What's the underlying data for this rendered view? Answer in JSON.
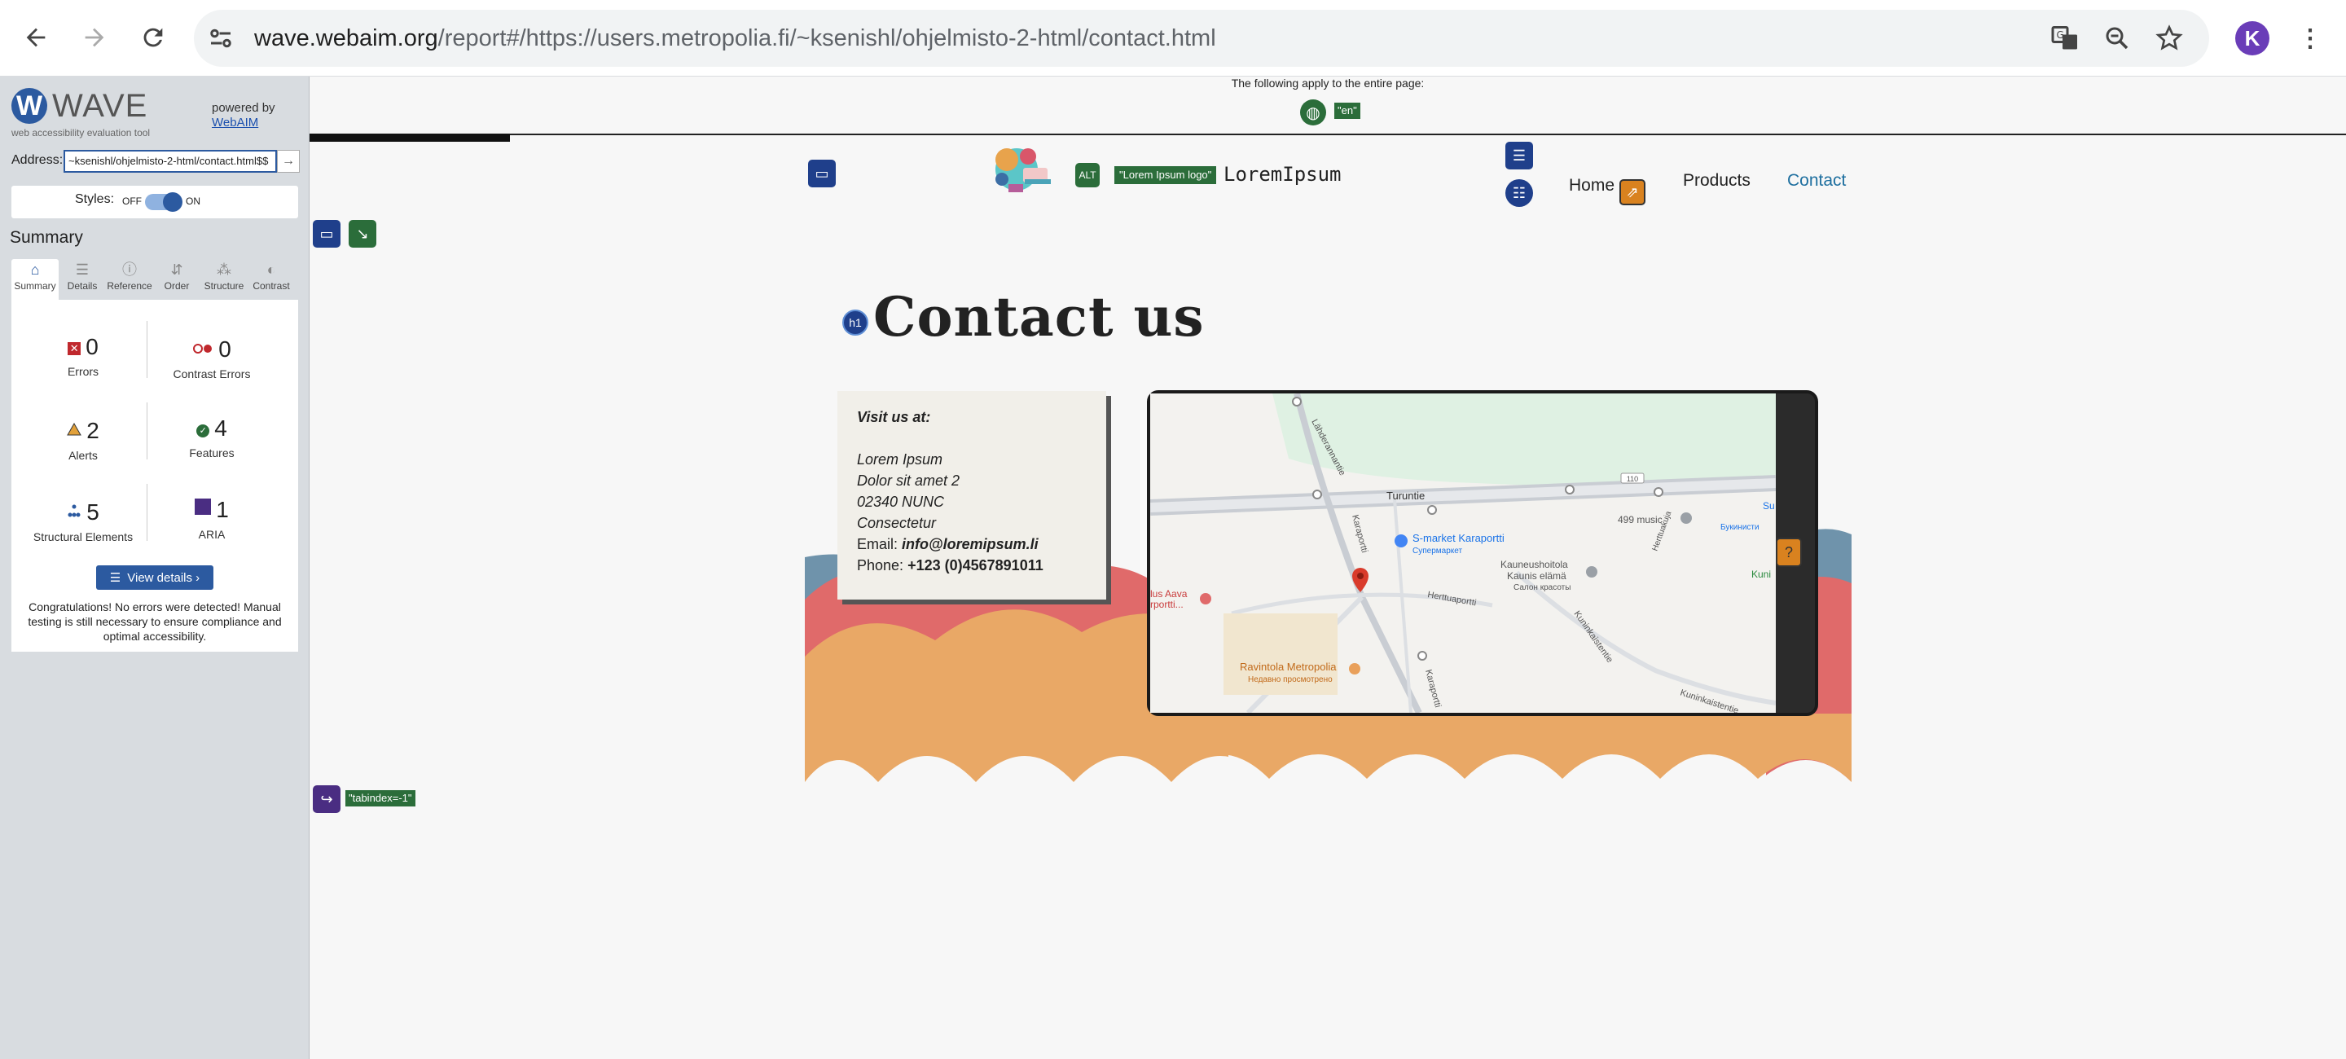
{
  "browser": {
    "url_host": "wave.webaim.org",
    "url_path": "/report#/https://users.metropolia.fi/~ksenishl/ohjelmisto-2-html/contact.html",
    "avatar_letter": "K"
  },
  "wave": {
    "logo_letter": "W",
    "title": "WAVE",
    "subtitle": "web accessibility evaluation tool",
    "powered_by": "powered by",
    "webaim": "WebAIM",
    "address_label": "Address:",
    "address_value": "~ksenishl/ohjelmisto-2-html/contact.html$$",
    "go_symbol": "→",
    "styles_label": "Styles:",
    "styles_off": "OFF",
    "styles_on": "ON",
    "summary_heading": "Summary",
    "tabs": [
      {
        "label": "Summary",
        "icon": "⌂"
      },
      {
        "label": "Details",
        "icon": "☰"
      },
      {
        "label": "Reference",
        "icon": "ⓘ"
      },
      {
        "label": "Order",
        "icon": "⇵"
      },
      {
        "label": "Structure",
        "icon": "⁂"
      },
      {
        "label": "Contrast",
        "icon": "◐"
      }
    ],
    "stats": {
      "errors": {
        "value": "0",
        "label": "Errors"
      },
      "contrast_errors": {
        "value": "0",
        "label": "Contrast Errors"
      },
      "alerts": {
        "value": "2",
        "label": "Alerts"
      },
      "features": {
        "value": "4",
        "label": "Features"
      },
      "structural": {
        "value": "5",
        "label": "Structural Elements"
      },
      "aria": {
        "value": "1",
        "label": "ARIA"
      }
    },
    "view_details": "View details ›",
    "congrats": "Congratulations! No errors were detected! Manual testing is still necessary to ensure compliance and optimal accessibility."
  },
  "page": {
    "apply_text": "The following apply to the entire page:",
    "lang_tag": "\"en\"",
    "logo_alt_tag": "\"Lorem Ipsum logo\"",
    "site_name": "LoremIpsum",
    "nav": [
      "Home",
      "Products",
      "Contact"
    ],
    "h1_badge": "h1",
    "title": "Contact us",
    "card": {
      "visit": "Visit us at:",
      "address_lines": [
        "Lorem Ipsum",
        "Dolor sit amet 2",
        "02340 NUNC",
        "Consectetur"
      ],
      "email_label": "Email:",
      "email": "info@loremipsum.li",
      "phone_label": "Phone:",
      "phone": "+123 (0)4567891011"
    },
    "map_labels": {
      "turuntie": "Turuntie",
      "music": "499 music",
      "smarket": "S-market Karaportti",
      "smarket_ru": "Супермаркет",
      "kauneus": "Kauneushoitola",
      "kaunis": "Kaunis elämä",
      "kaunis_ru": "Салон красоты",
      "hertta": "Herttuaportti",
      "ravintola": "Ravintola Metropolia",
      "ravintola_ru": "Недавно просмотрено",
      "lus": "lus Aava",
      "lus2": "rportti...",
      "kuninkaistentie": "Kuninkaistentie",
      "karaportti": "Karaportti",
      "lahderanta": "Lähderannantie",
      "road110": "110",
      "su": "Su",
      "bukin": "Букинисти",
      "kuni": "Kuni",
      "herttuak": "Herttuakuja"
    },
    "tabindex_tag": "\"tabindex=-1\""
  }
}
